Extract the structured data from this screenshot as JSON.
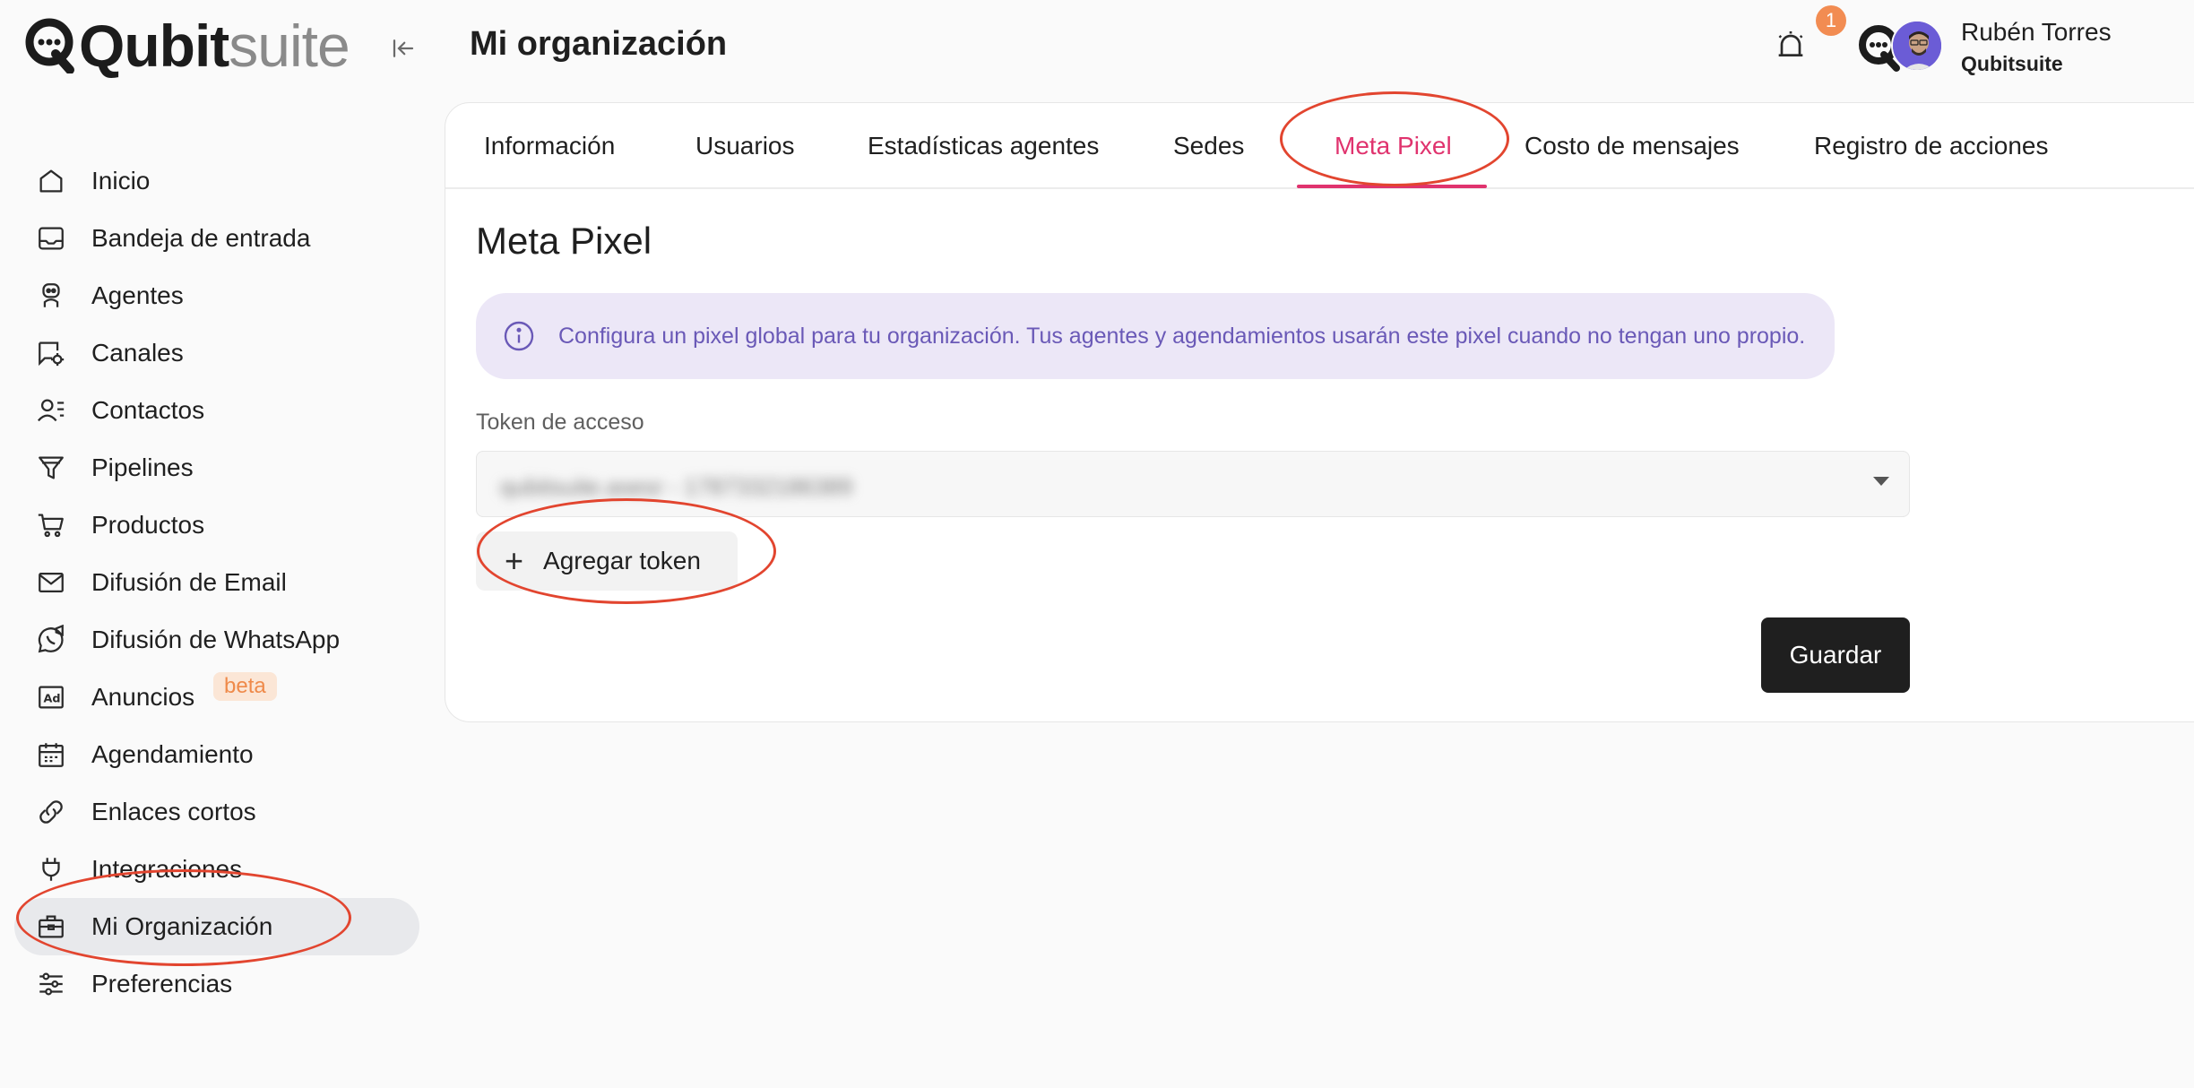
{
  "brand": {
    "name_part1": "Qubit",
    "name_part2": "suite"
  },
  "header": {
    "title": "Mi organización",
    "notifications_count": "1",
    "user_name": "Rubén Torres",
    "user_org": "Qubitsuite"
  },
  "sidebar": {
    "items": [
      {
        "label": "Inicio",
        "icon": "home-icon"
      },
      {
        "label": "Bandeja de entrada",
        "icon": "inbox-icon"
      },
      {
        "label": "Agentes",
        "icon": "robot-icon"
      },
      {
        "label": "Canales",
        "icon": "chat-settings-icon"
      },
      {
        "label": "Contactos",
        "icon": "contacts-icon"
      },
      {
        "label": "Pipelines",
        "icon": "funnel-icon"
      },
      {
        "label": "Productos",
        "icon": "cart-icon"
      },
      {
        "label": "Difusión de Email",
        "icon": "mail-icon"
      },
      {
        "label": "Difusión de WhatsApp",
        "icon": "whatsapp-megaphone-icon"
      },
      {
        "label": "Anuncios",
        "icon": "ad-icon",
        "badge": "beta"
      },
      {
        "label": "Agendamiento",
        "icon": "calendar-icon"
      },
      {
        "label": "Enlaces cortos",
        "icon": "link-icon"
      },
      {
        "label": "Integraciones",
        "icon": "plug-icon"
      },
      {
        "label": "Mi Organización",
        "icon": "briefcase-icon",
        "active": true
      },
      {
        "label": "Preferencias",
        "icon": "sliders-icon"
      }
    ]
  },
  "tabs": [
    {
      "label": "Información"
    },
    {
      "label": "Usuarios"
    },
    {
      "label": "Estadísticas agentes"
    },
    {
      "label": "Sedes"
    },
    {
      "label": "Meta Pixel",
      "active": true
    },
    {
      "label": "Costo de mensajes"
    },
    {
      "label": "Registro de acciones"
    }
  ],
  "meta_pixel": {
    "title": "Meta Pixel",
    "info": "Configura un pixel global para tu organización. Tus agentes y agendamientos usarán este pixel cuando no tengan uno propio.",
    "token_label": "Token de acceso",
    "token_value": "qubitsuite.asesr - 1787332186389",
    "add_token_label": "Agregar token",
    "save_label": "Guardar"
  },
  "colors": {
    "accent": "#e0336e",
    "info_bg": "#ece7f7",
    "info_text": "#6a59b7",
    "annotation": "#e2452f",
    "badge": "#f28c52"
  }
}
